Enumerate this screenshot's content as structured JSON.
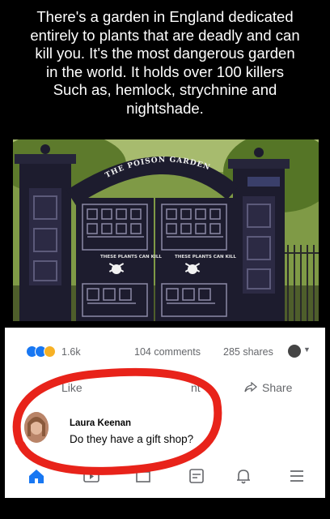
{
  "headline": {
    "line1": "There's a garden in England dedicated",
    "line2": "entirely to plants that are deadly and can",
    "line3": "kill you. It's the most dangerous garden",
    "line4": "in the world. It holds over 100 killers",
    "line5": "Such as, hemlock, strychnine and",
    "line6": "nightshade."
  },
  "photo": {
    "arch_text": "THE POISON GARDEN",
    "sign_text_left": "THESE PLANTS CAN KILL",
    "sign_text_right": "THESE PLANTS CAN KILL"
  },
  "post": {
    "reaction_count": "1.6k",
    "comments": "104 comments",
    "shares": "285 shares",
    "like_label": "Like",
    "comment_label": "nt",
    "share_label": "Share"
  },
  "comment": {
    "author": "Laura Keenan",
    "text": "Do they have a gift shop?"
  },
  "colors": {
    "facebook_blue": "#1877f2",
    "highlight_red": "#e8231a",
    "gate_dark": "#1d1c2e"
  }
}
